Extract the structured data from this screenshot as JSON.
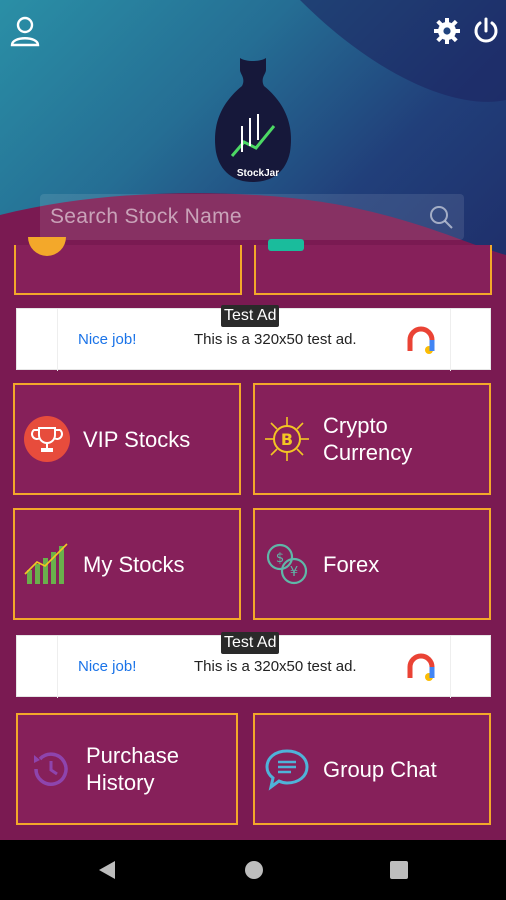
{
  "app": {
    "logo_text": "StockJar"
  },
  "search": {
    "placeholder": "Search Stock Name"
  },
  "tiles": [
    {
      "id": "vip",
      "label": "VIP Stocks",
      "icon": "trophy-icon"
    },
    {
      "id": "crypto",
      "label_line1": "Crypto",
      "label_line2": "Currency",
      "icon": "bitcoin-icon"
    },
    {
      "id": "mystocks",
      "label": "My Stocks",
      "icon": "bar-chart-icon"
    },
    {
      "id": "forex",
      "label": "Forex",
      "icon": "coins-exchange-icon"
    },
    {
      "id": "history",
      "label_line1": "Purchase",
      "label_line2": "History",
      "icon": "history-icon"
    },
    {
      "id": "chat",
      "label": "Group Chat",
      "icon": "chat-icon"
    }
  ],
  "ads": [
    {
      "badge": "Test Ad",
      "headline": "Nice job!",
      "text": "This is a 320x50 test ad."
    },
    {
      "badge": "Test Ad",
      "headline": "Nice job!",
      "text": "This is a 320x50 test ad."
    }
  ],
  "colors": {
    "accent_border": "#f3a82a",
    "tile_bg": "#86205a",
    "page_bg": "#7a1a52"
  }
}
